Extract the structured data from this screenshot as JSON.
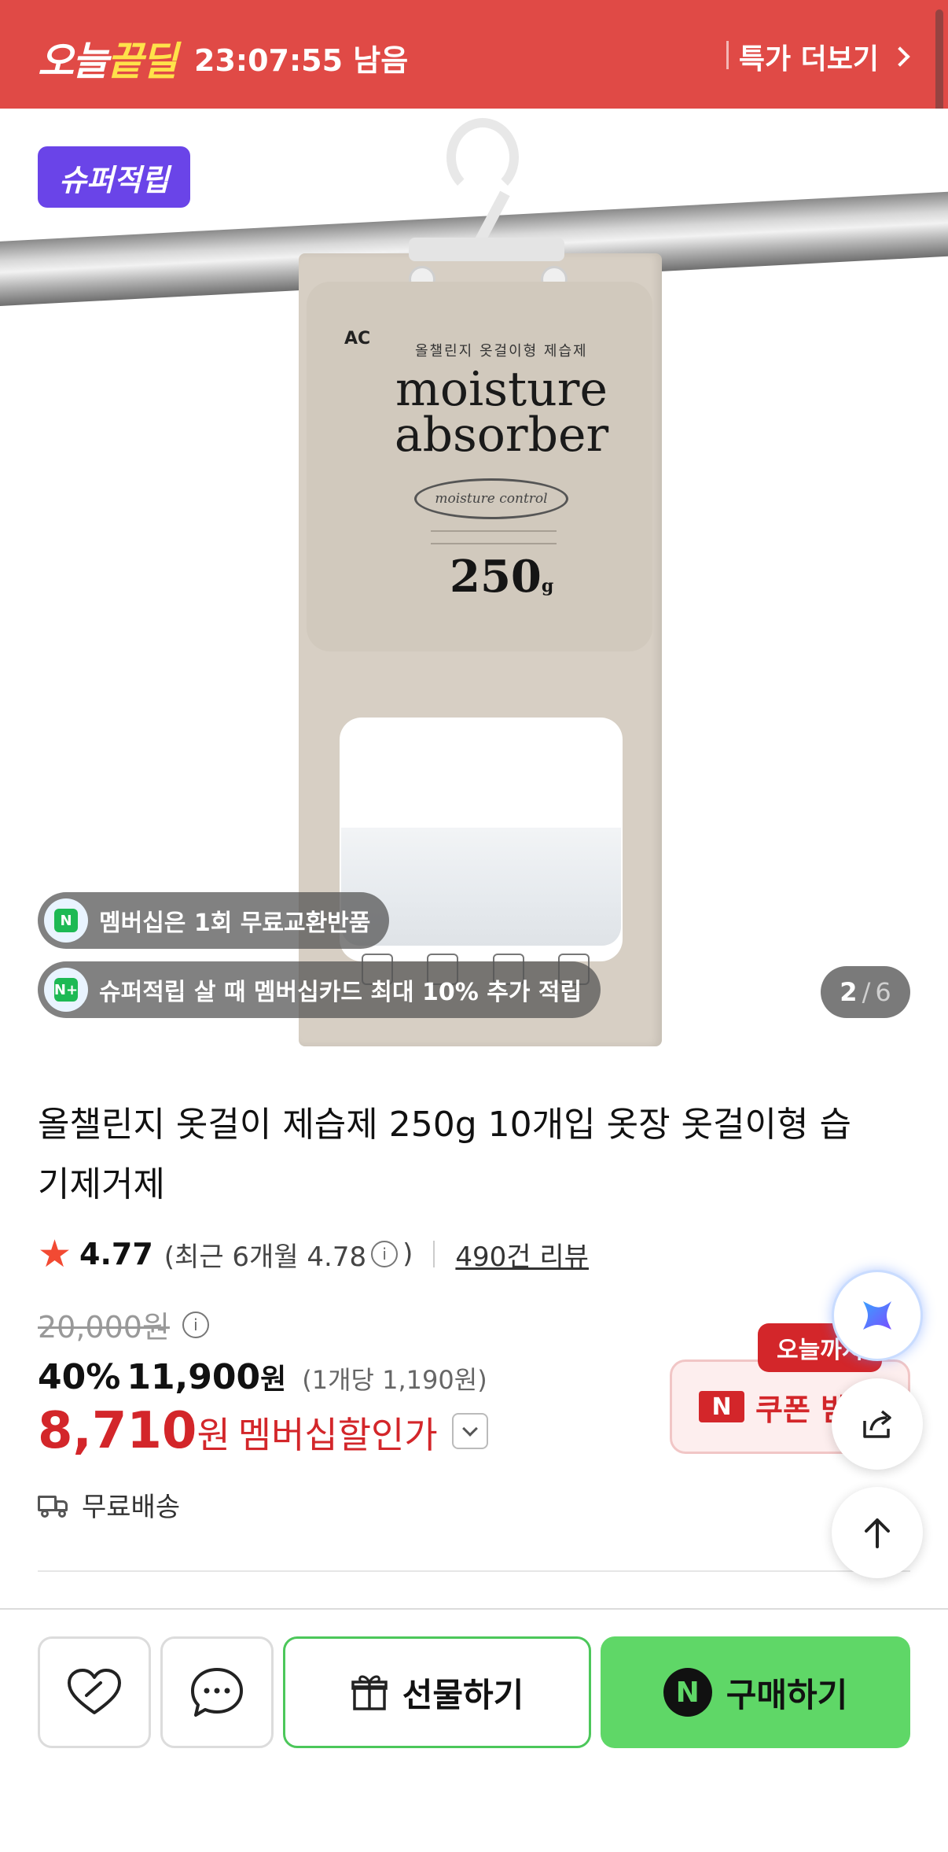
{
  "deal_bar": {
    "logo_part1": "오늘",
    "logo_part2": "끝딜",
    "timer": "23:07:55 남음",
    "more_label": "특가 더보기"
  },
  "product_image": {
    "badge": "슈퍼적립",
    "pouch_brand": "AC",
    "pouch_korean": "올챌린지 옷걸이형 제습제",
    "pouch_title_line1": "moisture",
    "pouch_title_line2": "absorber",
    "pouch_oval": "moisture control",
    "pouch_weight": "250",
    "pouch_weight_unit": "g",
    "chips": [
      {
        "icon": "membership-return-icon",
        "icon_text": "N",
        "label": "멤버십은 1회 무료교환반품"
      },
      {
        "icon": "membership-card-icon",
        "icon_text": "N+",
        "label": "슈퍼적립 살 때 멤버십카드 최대 10% 추가 적립"
      }
    ],
    "pager": {
      "current": "2",
      "separator": "/",
      "total": "6"
    }
  },
  "product": {
    "title": "올챌린지 옷걸이 제습제 250g 10개입 옷장 옷걸이형 습기제거제",
    "rating": {
      "score": "4.77",
      "recent_prefix": "(최근 6개월 4.78",
      "recent_suffix": ")",
      "reviews": "490건 리뷰"
    },
    "original_price": "20,000원",
    "discount_rate": "40%",
    "sale_price": "11,900",
    "sale_unit": "원",
    "per_unit": "(1개당 1,190원)",
    "member_price": "8,710",
    "member_unit": "원",
    "member_label": "멤버십할인가",
    "shipping": "무료배송"
  },
  "coupon": {
    "tag": "오늘까지",
    "n_mark": "N",
    "label": "쿠폰 받기"
  },
  "bottom_bar": {
    "gift_label": "선물하기",
    "buy_mark": "N",
    "buy_label": "구매하기"
  },
  "colors": {
    "deal_red": "#e04a46",
    "badge_purple": "#6a44e8",
    "price_red": "#d3262a",
    "buy_green": "#5fd767",
    "star": "#f24a33"
  }
}
